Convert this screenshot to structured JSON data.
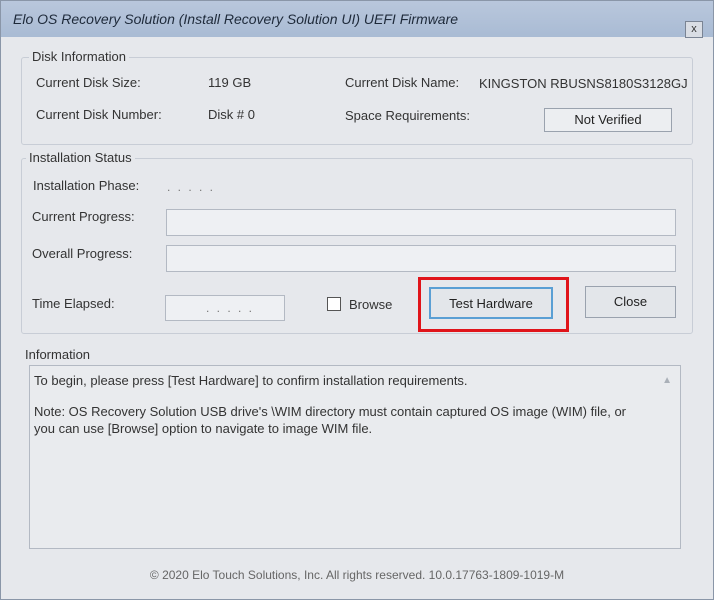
{
  "window": {
    "title": "Elo OS Recovery Solution (Install Recovery Solution UI) UEFI Firmware",
    "close_glyph": "x"
  },
  "disk_info": {
    "legend": "Disk Information",
    "size_label": "Current Disk Size:",
    "size_value": "119 GB",
    "name_label": "Current Disk Name:",
    "name_value": "KINGSTON RBUSNS8180S3128GJ",
    "number_label": "Current Disk Number:",
    "number_value": "Disk # 0",
    "space_label": "Space Requirements:",
    "space_value": "Not Verified"
  },
  "install_status": {
    "legend": "Installation Status",
    "phase_label": "Installation Phase:",
    "phase_value": ". . . . .",
    "current_progress_label": "Current Progress:",
    "current_progress": 0,
    "overall_progress_label": "Overall Progress:",
    "overall_progress": 0,
    "time_label": "Time Elapsed:",
    "time_value": ". . . . .",
    "browse_label": "Browse",
    "browse_checked": false,
    "test_button": "Test Hardware",
    "close_button": "Close"
  },
  "information": {
    "legend": "Information",
    "line1": "To begin, please press [Test Hardware] to confirm installation requirements.",
    "line2": "Note: OS Recovery Solution USB drive's \\WIM directory must contain captured OS image (WIM) file, or you can use [Browse] option to navigate to image WIM file."
  },
  "footer": "© 2020 Elo Touch Solutions, Inc. All rights reserved. 10.0.17763-1809-1019-M",
  "colors": {
    "highlight": "#e0141a",
    "accent_border": "#5a9fd4"
  }
}
